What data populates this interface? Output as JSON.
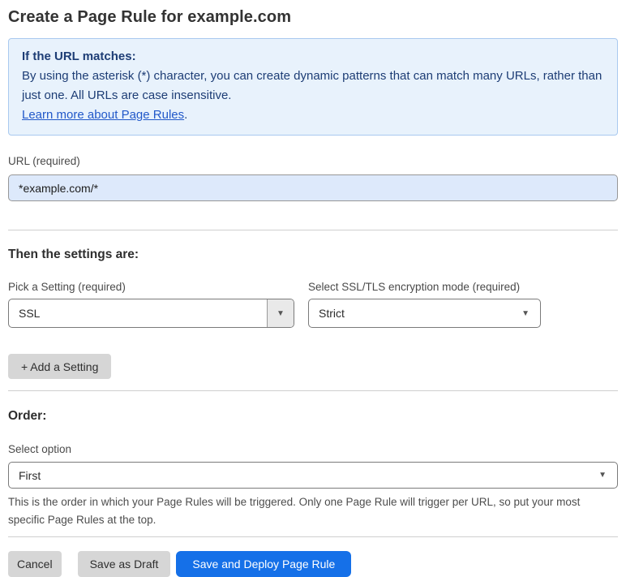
{
  "page": {
    "title": "Create a Page Rule for example.com"
  },
  "info_box": {
    "heading": "If the URL matches:",
    "body": "By using the asterisk (*) character, you can create dynamic patterns that can match many URLs, rather than just one. All URLs are case insensitive.",
    "link_label": "Learn more about Page Rules",
    "link_suffix": "."
  },
  "url_field": {
    "label": "URL (required)",
    "value": "*example.com/*"
  },
  "settings_section": {
    "heading": "Then the settings are:",
    "setting_picker": {
      "label": "Pick a Setting (required)",
      "selected": "SSL"
    },
    "ssl_mode_picker": {
      "label": "Select SSL/TLS encryption mode (required)",
      "selected": "Strict"
    },
    "add_setting_label": "+ Add a Setting"
  },
  "order_section": {
    "heading": "Order:",
    "select_label": "Select option",
    "selected": "First",
    "help_text": "This is the order in which your Page Rules will be triggered. Only one Page Rule will trigger per URL, so put your most specific Page Rules at the top."
  },
  "footer": {
    "cancel_label": "Cancel",
    "save_draft_label": "Save as Draft",
    "save_deploy_label": "Save and Deploy Page Rule"
  },
  "icons": {
    "dropdown_arrow": "▼"
  },
  "colors": {
    "accent_blue": "#1570e8",
    "info_box_bg": "#e8f2fc",
    "info_box_border": "#a9c9ef",
    "info_text": "#1d3d75",
    "link_blue": "#2158c9",
    "url_input_bg": "#dde9fb",
    "gray_button_bg": "#d6d6d6"
  }
}
